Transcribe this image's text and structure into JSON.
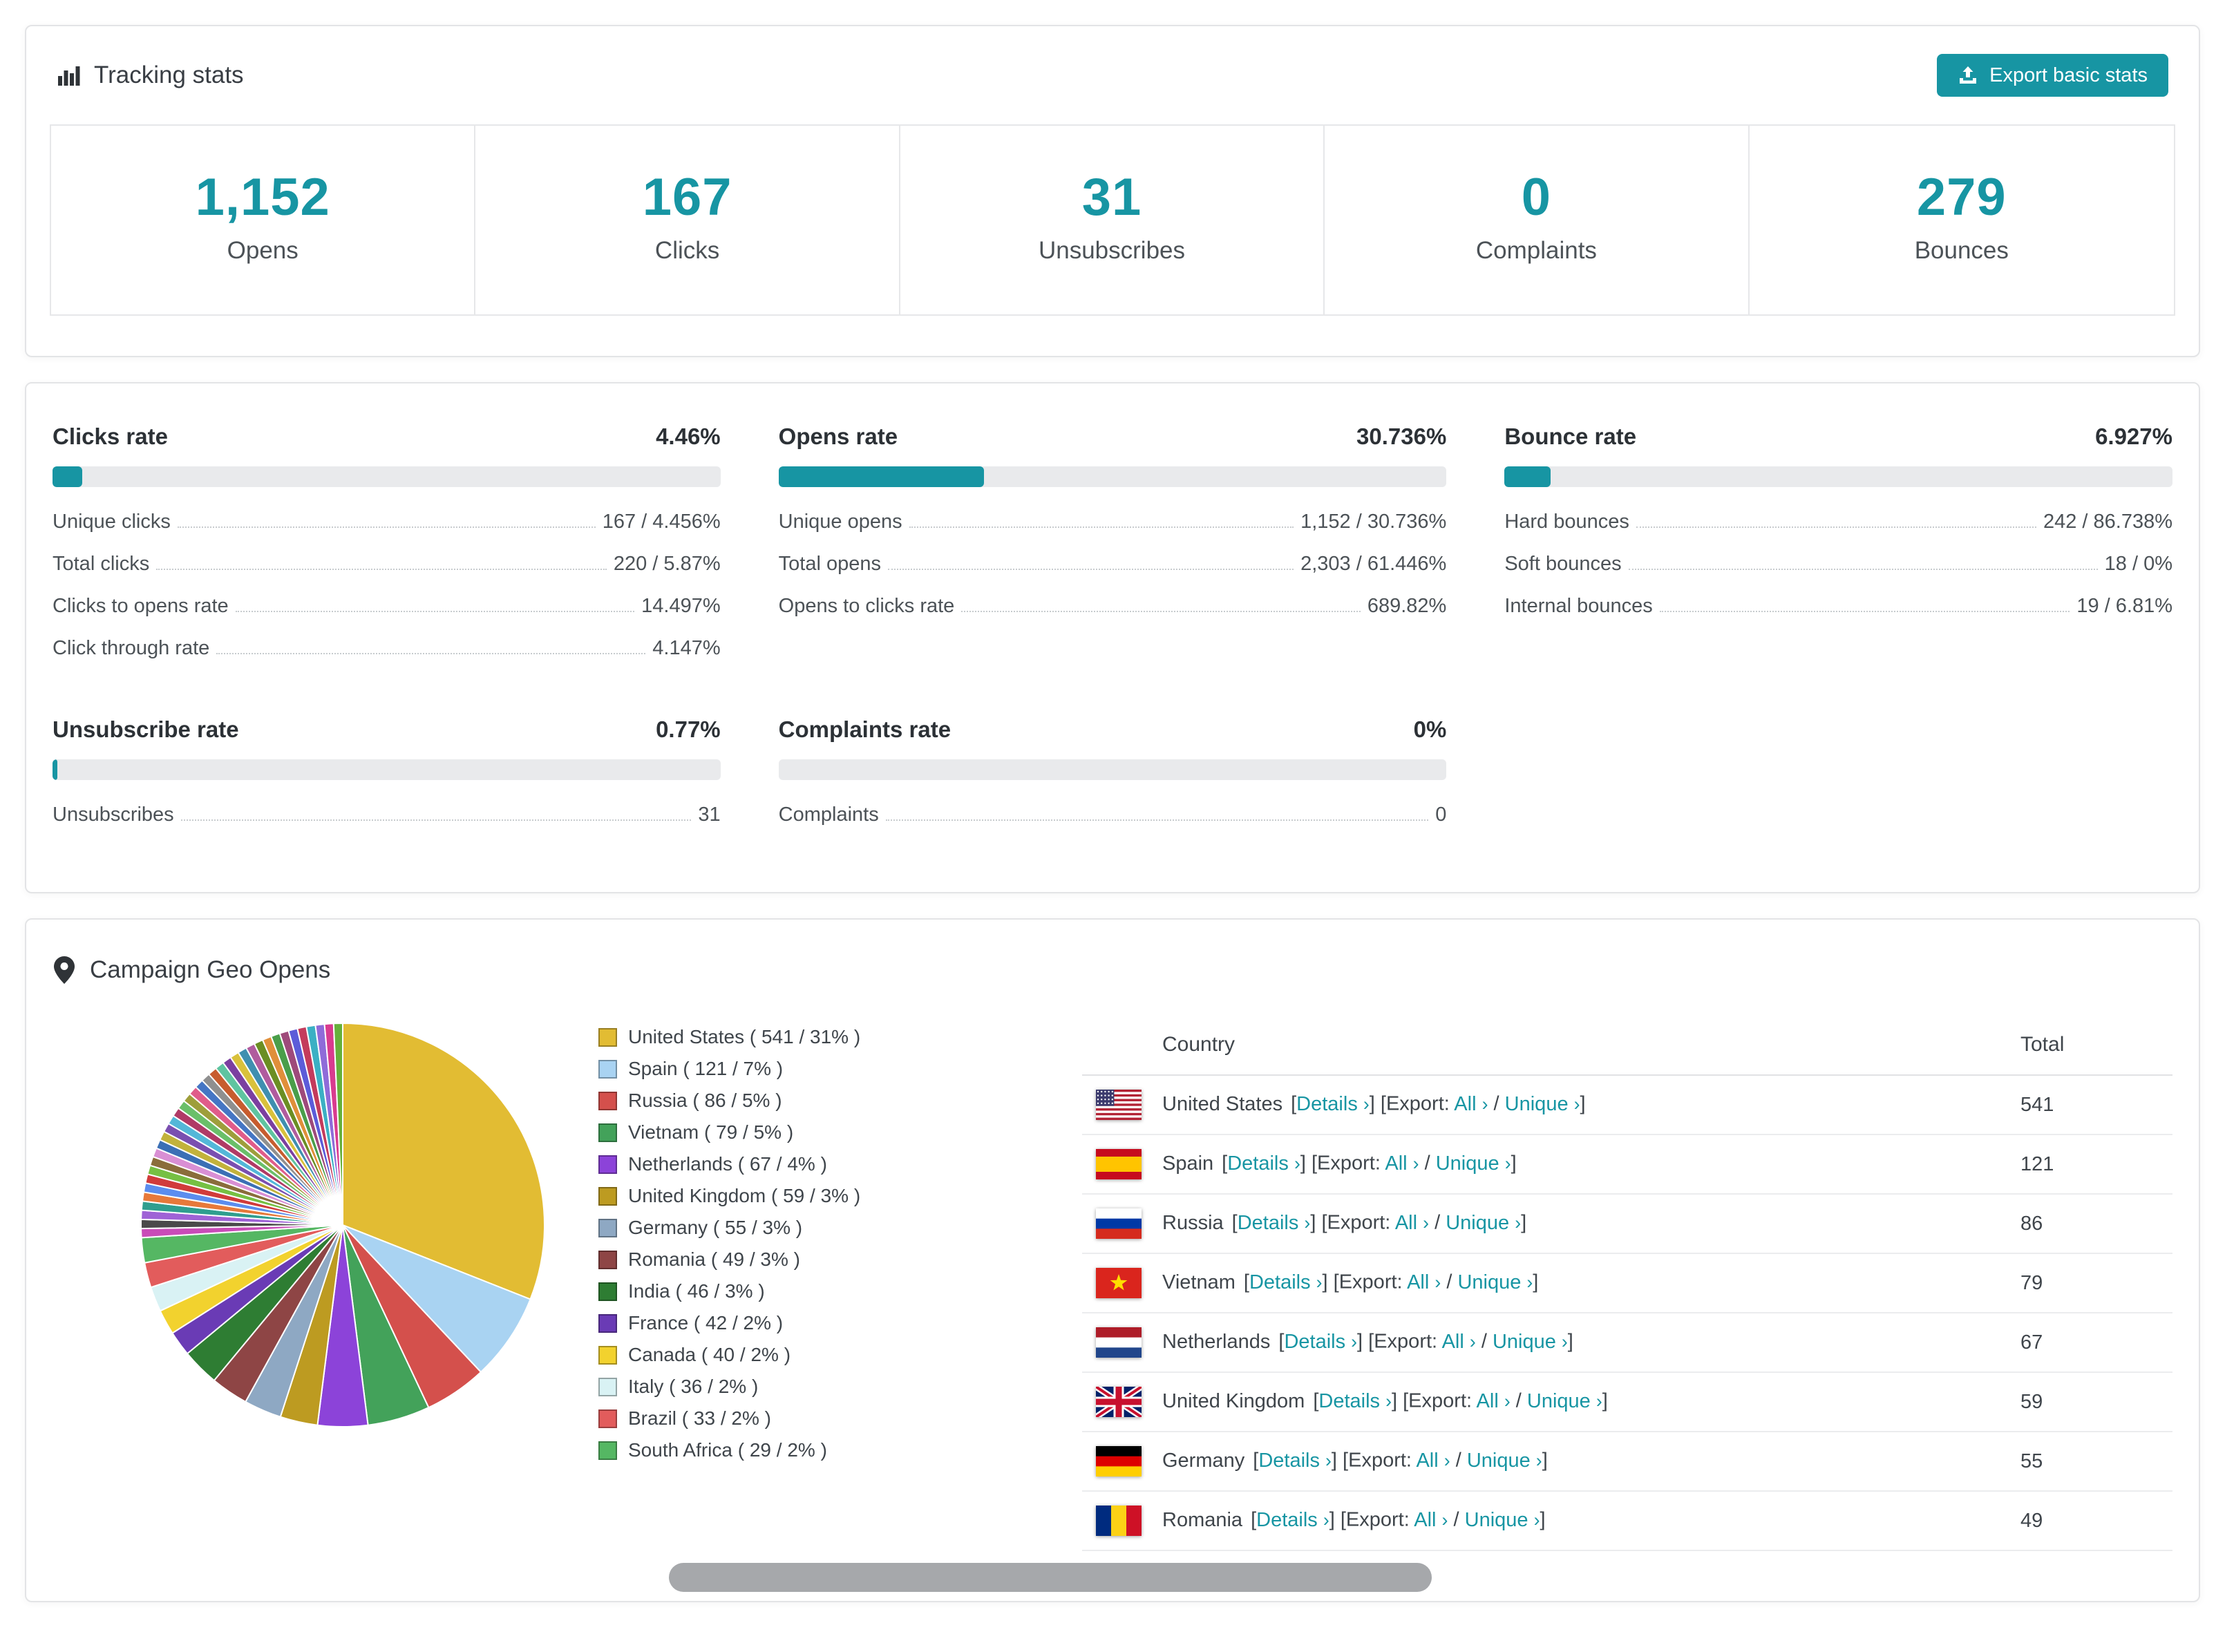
{
  "accent_color": "#1795a3",
  "tracking": {
    "title": "Tracking stats",
    "export_button": "Export basic stats",
    "stats": [
      {
        "value": "1,152",
        "label": "Opens"
      },
      {
        "value": "167",
        "label": "Clicks"
      },
      {
        "value": "31",
        "label": "Unsubscribes"
      },
      {
        "value": "0",
        "label": "Complaints"
      },
      {
        "value": "279",
        "label": "Bounces"
      }
    ]
  },
  "rates": {
    "blocks": [
      {
        "title": "Clicks rate",
        "value": "4.46%",
        "percent": 4.46,
        "rows": [
          {
            "label": "Unique clicks",
            "value": "167 / 4.456%"
          },
          {
            "label": "Total clicks",
            "value": "220 / 5.87%"
          },
          {
            "label": "Clicks to opens rate",
            "value": "14.497%"
          },
          {
            "label": "Click through rate",
            "value": "4.147%"
          }
        ]
      },
      {
        "title": "Opens rate",
        "value": "30.736%",
        "percent": 30.736,
        "rows": [
          {
            "label": "Unique opens",
            "value": "1,152 / 30.736%"
          },
          {
            "label": "Total opens",
            "value": "2,303 / 61.446%"
          },
          {
            "label": "Opens to clicks rate",
            "value": "689.82%"
          }
        ]
      },
      {
        "title": "Bounce rate",
        "value": "6.927%",
        "percent": 6.927,
        "rows": [
          {
            "label": "Hard bounces",
            "value": "242 / 86.738%"
          },
          {
            "label": "Soft bounces",
            "value": "18 / 0%"
          },
          {
            "label": "Internal bounces",
            "value": "19 / 6.81%"
          }
        ]
      },
      {
        "title": "Unsubscribe rate",
        "value": "0.77%",
        "percent": 0.77,
        "rows": [
          {
            "label": "Unsubscribes",
            "value": "31"
          }
        ]
      },
      {
        "title": "Complaints rate",
        "value": "0%",
        "percent": 0,
        "rows": [
          {
            "label": "Complaints",
            "value": "0"
          }
        ]
      }
    ]
  },
  "geo": {
    "title": "Campaign Geo Opens",
    "table": {
      "headers": [
        "Country",
        "Total"
      ],
      "link_labels": {
        "details": "Details",
        "export": "Export:",
        "all": "All",
        "unique": "Unique",
        "chevron": "›",
        "open_bracket": "[",
        "close_bracket": "]",
        "slash": "/"
      },
      "rows": [
        {
          "country": "United States",
          "flag": "us",
          "total": "541"
        },
        {
          "country": "Spain",
          "flag": "es",
          "total": "121"
        },
        {
          "country": "Russia",
          "flag": "ru",
          "total": "86"
        },
        {
          "country": "Vietnam",
          "flag": "vn",
          "total": "79"
        },
        {
          "country": "Netherlands",
          "flag": "nl",
          "total": "67"
        },
        {
          "country": "United Kingdom",
          "flag": "gb",
          "total": "59"
        },
        {
          "country": "Germany",
          "flag": "de",
          "total": "55"
        },
        {
          "country": "Romania",
          "flag": "ro",
          "total": "49"
        }
      ]
    }
  },
  "chart_data": {
    "type": "pie",
    "title": "Campaign Geo Opens",
    "legend_position": "right",
    "slices": [
      {
        "label": "United States",
        "count": 541,
        "percent": 31,
        "color": "#e2bc33"
      },
      {
        "label": "Spain",
        "count": 121,
        "percent": 7,
        "color": "#a9d3f2"
      },
      {
        "label": "Russia",
        "count": 86,
        "percent": 5,
        "color": "#d4504c"
      },
      {
        "label": "Vietnam",
        "count": 79,
        "percent": 5,
        "color": "#43a25a"
      },
      {
        "label": "Netherlands",
        "count": 67,
        "percent": 4,
        "color": "#8c43d9"
      },
      {
        "label": "United Kingdom",
        "count": 59,
        "percent": 3,
        "color": "#bd9b21"
      },
      {
        "label": "Germany",
        "count": 55,
        "percent": 3,
        "color": "#8ea8c3"
      },
      {
        "label": "Romania",
        "count": 49,
        "percent": 3,
        "color": "#8e4545"
      },
      {
        "label": "India",
        "count": 46,
        "percent": 3,
        "color": "#2e7d33"
      },
      {
        "label": "France",
        "count": 42,
        "percent": 2,
        "color": "#6a3bb5"
      },
      {
        "label": "Canada",
        "count": 40,
        "percent": 2,
        "color": "#f2d22e"
      },
      {
        "label": "Italy",
        "count": 36,
        "percent": 2,
        "color": "#d9f2f4"
      },
      {
        "label": "Brazil",
        "count": 33,
        "percent": 2,
        "color": "#e25c5c"
      },
      {
        "label": "South Africa",
        "count": 29,
        "percent": 2,
        "color": "#55b763"
      }
    ],
    "other_slices": {
      "total_percent": 26,
      "colors": [
        "#c94cb8",
        "#4a4a4a",
        "#9f62d6",
        "#2f9e8f",
        "#e7793a",
        "#5b8def",
        "#d13b3b",
        "#76c043",
        "#8a6d3b",
        "#d98fd4",
        "#3b6fb5",
        "#c2b23b",
        "#7a4fb0",
        "#53b7d8",
        "#b03a66",
        "#6abf69",
        "#9e9e3b",
        "#e05c8a",
        "#4576c4",
        "#8f8f8f",
        "#c75c2e",
        "#5fc4a0",
        "#7b3fa0",
        "#d9c13b",
        "#3f8fb0",
        "#b05c9e",
        "#6b8e23",
        "#e08f3a",
        "#4a9e4a",
        "#9e4a7b",
        "#5c5cd9",
        "#c43b5c",
        "#3bb0c4",
        "#8f6bd9",
        "#d93b8f",
        "#66b03b"
      ]
    }
  }
}
